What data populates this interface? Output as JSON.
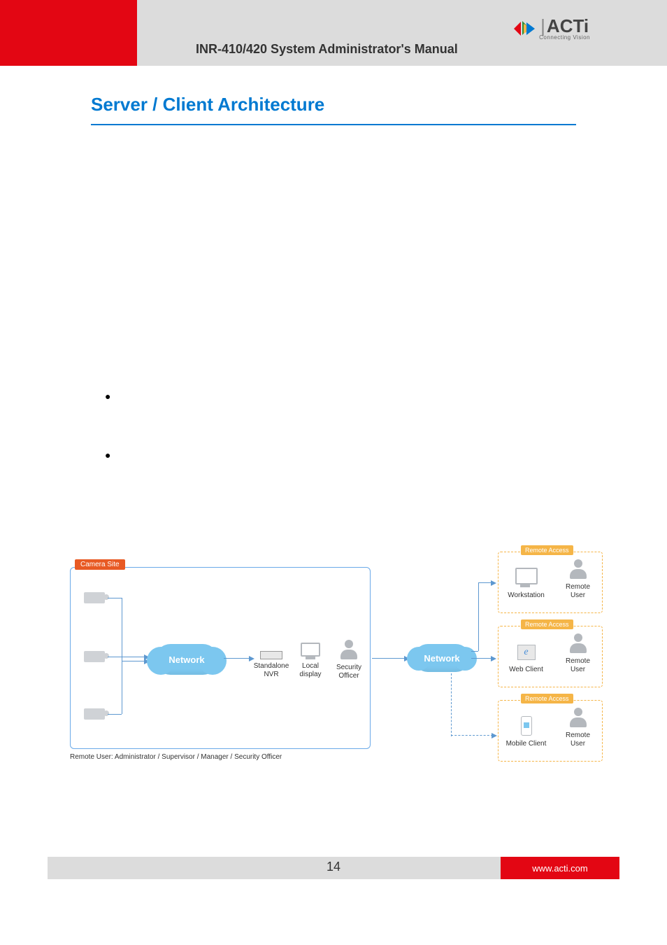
{
  "header": {
    "title": "INR-410/420 System Administrator's Manual",
    "logo_main": "ACTi",
    "logo_sub": "Connecting Vision"
  },
  "section": {
    "title": "Server / Client Architecture"
  },
  "diagram": {
    "camera_site": "Camera Site",
    "network": "Network",
    "standalone_nvr": "Standalone\nNVR",
    "local_display": "Local display",
    "security_officer": "Security\nOfficer",
    "remote_access": "Remote Access",
    "workstation": "Workstation",
    "remote_user": "Remote\nUser",
    "web_client": "Web Client",
    "mobile_client": "Mobile Client",
    "caption": "Remote User: Administrator / Supervisor / Manager / Security Officer"
  },
  "footer": {
    "page": "14",
    "url": "www.acti.com"
  }
}
